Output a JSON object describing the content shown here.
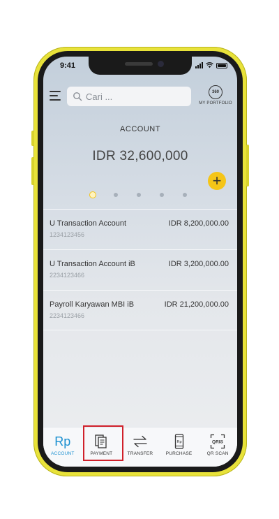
{
  "status_bar": {
    "time": "9:41"
  },
  "header": {
    "search_placeholder": "Cari ...",
    "portfolio_badge": "360",
    "portfolio_label": "MY PORTFOLIO"
  },
  "account_summary": {
    "title": "ACCOUNT",
    "total_balance": "IDR 32,600,000",
    "add_label": "+",
    "page_count": 5,
    "active_page": 1
  },
  "accounts": [
    {
      "name": "U Transaction Account",
      "number": "1234123456",
      "amount": "IDR 8,200,000.00"
    },
    {
      "name": "U Transaction Account iB",
      "number": "2234123466",
      "amount": "IDR 3,200,000.00"
    },
    {
      "name": "Payroll Karyawan MBI iB",
      "number": "2234123466",
      "amount": "IDR 21,200,000.00"
    }
  ],
  "bottom_nav": [
    {
      "label": "ACCOUNT",
      "icon": "rupiah-icon",
      "glyph": "Rp",
      "active": true
    },
    {
      "label": "PAYMENT",
      "icon": "payment-receipt-icon",
      "highlighted": true
    },
    {
      "label": "TRANSFER",
      "icon": "transfer-arrows-icon"
    },
    {
      "label": "PURCHASE",
      "icon": "mobile-purchase-icon",
      "glyph": "Rp"
    },
    {
      "label": "QR SCAN",
      "icon": "qris-scan-icon",
      "glyph": "QRIS"
    }
  ],
  "colors": {
    "frame": "#e8e23a",
    "accent_yellow": "#f5c518",
    "active_blue": "#1a8fd0",
    "highlight_red": "#d0202a"
  }
}
